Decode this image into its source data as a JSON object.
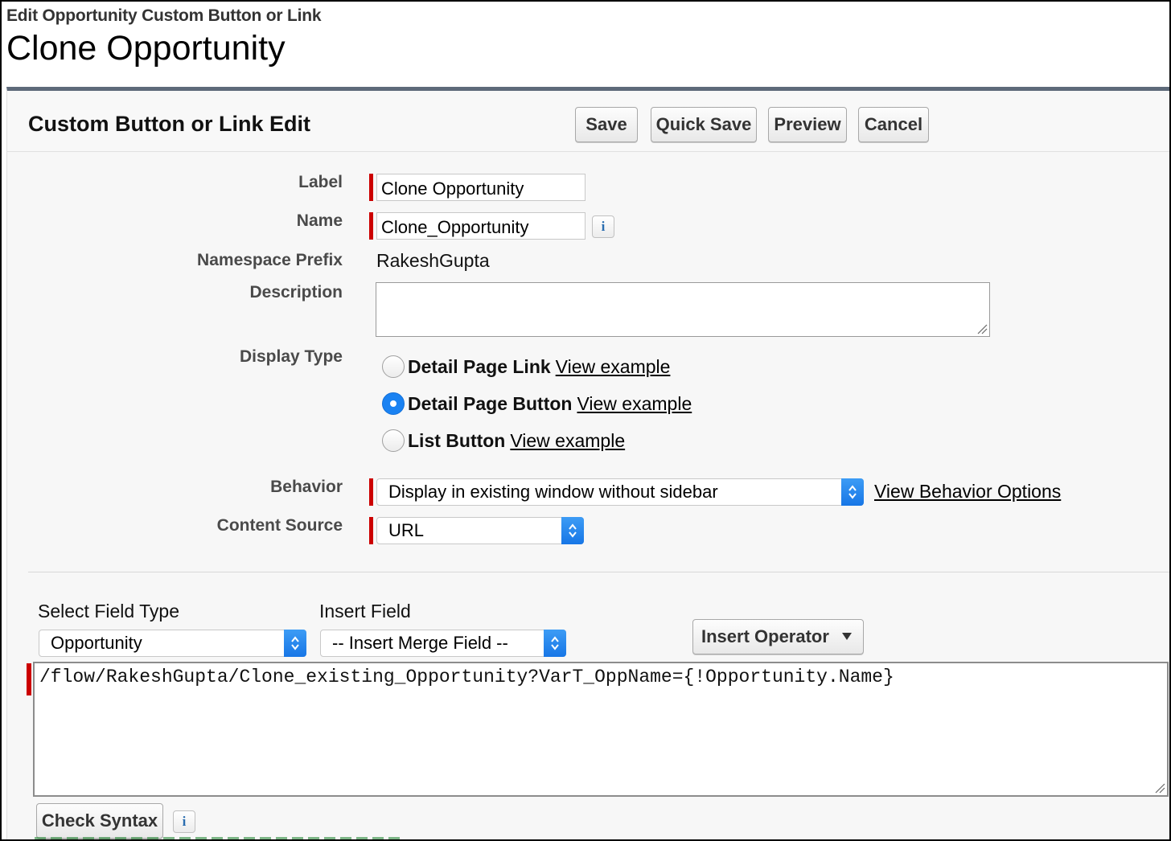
{
  "header": {
    "breadcrumb": "Edit Opportunity Custom Button or Link",
    "title": "Clone Opportunity"
  },
  "panel": {
    "title": "Custom Button or Link Edit",
    "buttons": {
      "save": "Save",
      "quick_save": "Quick Save",
      "preview": "Preview",
      "cancel": "Cancel"
    }
  },
  "form": {
    "label": {
      "caption": "Label",
      "value": "Clone Opportunity"
    },
    "name": {
      "caption": "Name",
      "value": "Clone_Opportunity",
      "info": "i"
    },
    "namespace": {
      "caption": "Namespace Prefix",
      "value": "RakeshGupta"
    },
    "description": {
      "caption": "Description",
      "value": ""
    },
    "display_type": {
      "caption": "Display Type",
      "options": [
        {
          "label": "Detail Page Link",
          "link": "View example",
          "checked": false
        },
        {
          "label": "Detail Page Button",
          "link": "View example",
          "checked": true
        },
        {
          "label": "List Button",
          "link": "View example",
          "checked": false
        }
      ]
    },
    "behavior": {
      "caption": "Behavior",
      "value": "Display in existing window without sidebar",
      "link": "View Behavior Options"
    },
    "content_source": {
      "caption": "Content Source",
      "value": "URL"
    }
  },
  "formula": {
    "select_field_type": {
      "caption": "Select Field Type",
      "value": "Opportunity"
    },
    "insert_field": {
      "caption": "Insert Field",
      "value": "-- Insert Merge Field --"
    },
    "insert_operator": "Insert Operator",
    "code": "/flow/RakeshGupta/Clone_existing_Opportunity?VarT_OppName={!Opportunity.Name}",
    "check_syntax": "Check Syntax",
    "info": "i"
  },
  "colors": {
    "required": "#cc0000",
    "panel_border": "#5e6a7a",
    "select_accent": "#1a82f2"
  }
}
